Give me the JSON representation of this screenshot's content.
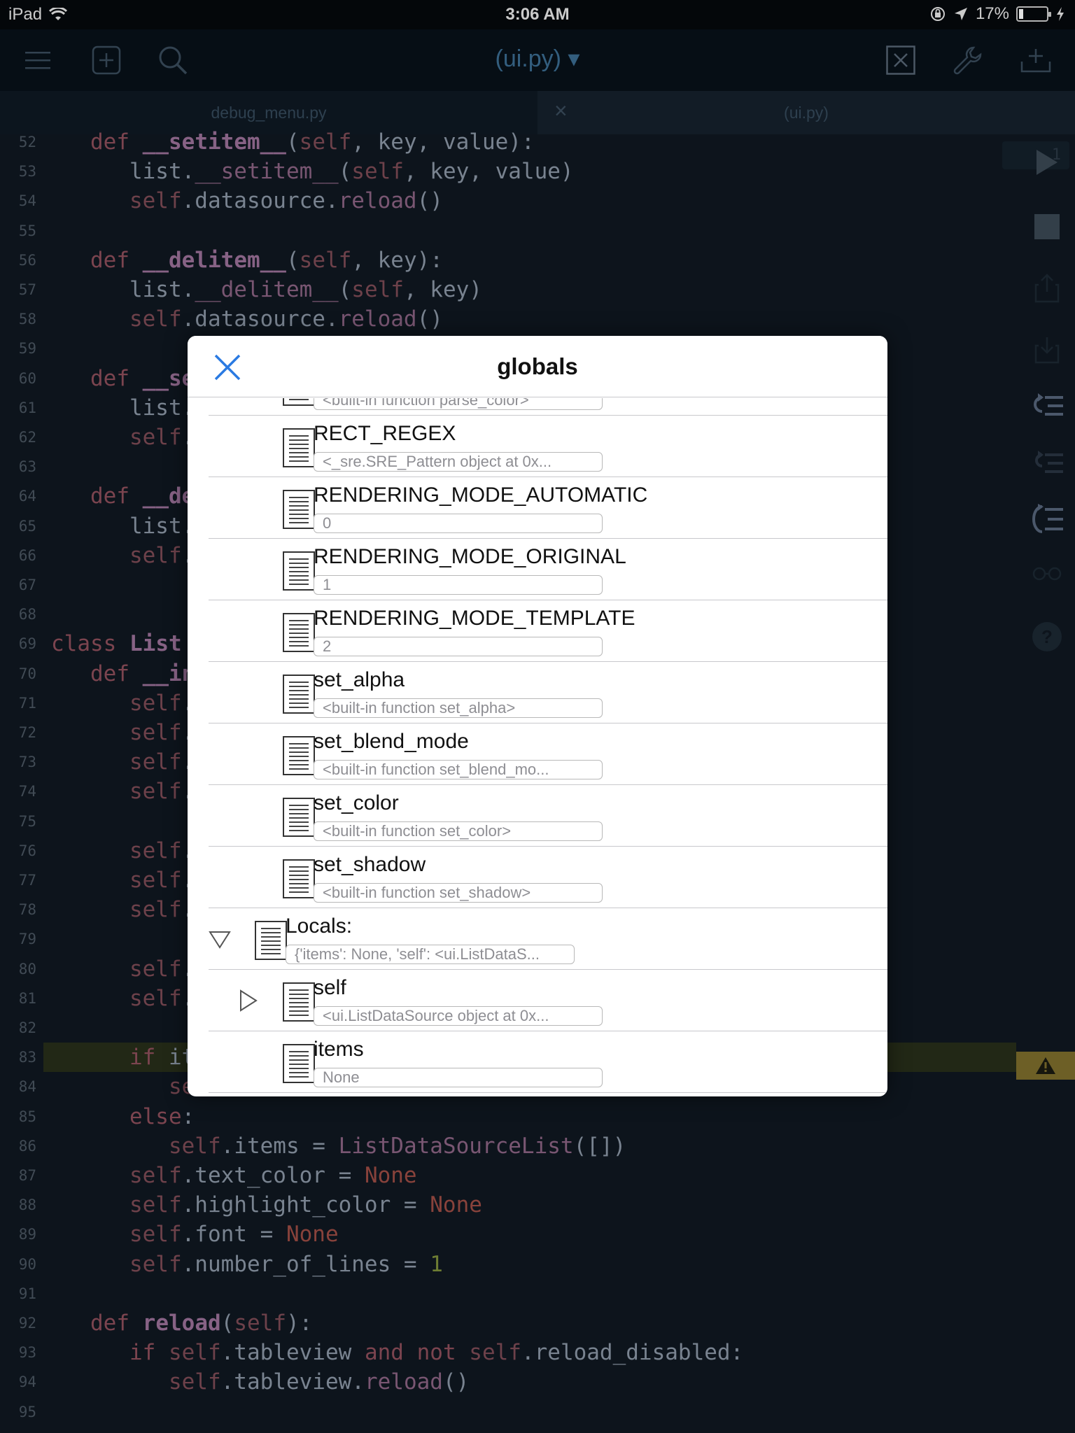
{
  "status_bar": {
    "device": "iPad",
    "time": "3:06 AM",
    "battery_percent": "17%",
    "battery_level": 0.17
  },
  "toolbar": {
    "title": "(ui.py) ▾"
  },
  "tabs": [
    {
      "label": "debug_menu.py",
      "close": ""
    },
    {
      "label": "(ui.py)",
      "close": "×"
    }
  ],
  "editor": {
    "lines": [
      {
        "n": "52",
        "html": "   <span class='kw'>def</span> <span class='fn'>__setitem__</span>(<span class='sf'>self</span>, key, value):"
      },
      {
        "n": "53",
        "html": "      list.<span class='mt'>__setitem__</span>(<span class='sf'>self</span>, key, value)"
      },
      {
        "n": "54",
        "html": "      <span class='sf'>self</span>.datasource.<span class='mt'>reload</span>()"
      },
      {
        "n": "55",
        "html": ""
      },
      {
        "n": "56",
        "html": "   <span class='kw'>def</span> <span class='fn'>__delitem__</span>(<span class='sf'>self</span>, key):"
      },
      {
        "n": "57",
        "html": "      list.<span class='mt'>__delitem__</span>(<span class='sf'>self</span>, key)"
      },
      {
        "n": "58",
        "html": "      <span class='sf'>self</span>.datasource.<span class='mt'>reload</span>()"
      },
      {
        "n": "59",
        "html": ""
      },
      {
        "n": "60",
        "html": "   <span class='kw'>def</span> <span class='fn'>__se</span>"
      },
      {
        "n": "61",
        "html": "      list."
      },
      {
        "n": "62",
        "html": "      <span class='sf'>self</span>."
      },
      {
        "n": "63",
        "html": ""
      },
      {
        "n": "64",
        "html": "   <span class='kw'>def</span> <span class='fn'>__de</span>"
      },
      {
        "n": "65",
        "html": "      list."
      },
      {
        "n": "66",
        "html": "      <span class='sf'>self</span>."
      },
      {
        "n": "67",
        "html": ""
      },
      {
        "n": "68",
        "html": ""
      },
      {
        "n": "69",
        "html": "<span class='kw'>class</span> <span class='fn'>List</span>"
      },
      {
        "n": "70",
        "html": "   <span class='kw'>def</span> <span class='fn'>__in</span>"
      },
      {
        "n": "71",
        "html": "      <span class='sf'>self</span>."
      },
      {
        "n": "72",
        "html": "      <span class='sf'>self</span>."
      },
      {
        "n": "73",
        "html": "      <span class='sf'>self</span>."
      },
      {
        "n": "74",
        "html": "      <span class='sf'>self</span>."
      },
      {
        "n": "75",
        "html": ""
      },
      {
        "n": "76",
        "html": "      <span class='sf'>self</span>."
      },
      {
        "n": "77",
        "html": "      <span class='sf'>self</span>."
      },
      {
        "n": "78",
        "html": "      <span class='sf'>self</span>."
      },
      {
        "n": "79",
        "html": ""
      },
      {
        "n": "80",
        "html": "      <span class='sf'>self</span>."
      },
      {
        "n": "81",
        "html": "      <span class='sf'>self</span>."
      },
      {
        "n": "82",
        "html": ""
      },
      {
        "n": "83",
        "html": "      <span class='kw'>if</span> it",
        "highlight": true
      },
      {
        "n": "84",
        "html": "         <span class='sf'>self</span>.items = items"
      },
      {
        "n": "85",
        "html": "      <span class='kw'>else</span>:"
      },
      {
        "n": "86",
        "html": "         <span class='sf'>self</span>.items = <span class='mt'>ListDataSourceList</span>([])"
      },
      {
        "n": "87",
        "html": "      <span class='sf'>self</span>.text_color = <span class='nn'>None</span>"
      },
      {
        "n": "88",
        "html": "      <span class='sf'>self</span>.highlight_color = <span class='nn'>None</span>"
      },
      {
        "n": "89",
        "html": "      <span class='sf'>self</span>.font = <span class='nn'>None</span>"
      },
      {
        "n": "90",
        "html": "      <span class='sf'>self</span>.number_of_lines = <span class='num'>1</span>"
      },
      {
        "n": "91",
        "html": ""
      },
      {
        "n": "92",
        "html": "   <span class='kw'>def</span> <span class='fn'>reload</span>(<span class='sf'>self</span>):"
      },
      {
        "n": "93",
        "html": "      <span class='kw'>if</span> <span class='sf'>self</span>.tableview <span class='kw'>and</span> <span class='kw'>not</span> <span class='sf'>self</span>.reload_disabled:"
      },
      {
        "n": "94",
        "html": "         <span class='sf'>self</span>.tableview.<span class='mt'>reload</span>()"
      },
      {
        "n": "95",
        "html": ""
      }
    ],
    "gutter_badge": "1"
  },
  "dialog": {
    "title": "globals",
    "rows": [
      {
        "name": "",
        "value": "<built-in function parse_color>",
        "indent": 1,
        "disclosure": ""
      },
      {
        "name": "RECT_REGEX",
        "value": "<_sre.SRE_Pattern object at 0x...",
        "indent": 1,
        "disclosure": ""
      },
      {
        "name": "RENDERING_MODE_AUTOMATIC",
        "value": "0",
        "indent": 1,
        "disclosure": ""
      },
      {
        "name": "RENDERING_MODE_ORIGINAL",
        "value": "1",
        "indent": 1,
        "disclosure": ""
      },
      {
        "name": "RENDERING_MODE_TEMPLATE",
        "value": "2",
        "indent": 1,
        "disclosure": ""
      },
      {
        "name": "set_alpha",
        "value": "<built-in function set_alpha>",
        "indent": 1,
        "disclosure": ""
      },
      {
        "name": "set_blend_mode",
        "value": "<built-in function set_blend_mo...",
        "indent": 1,
        "disclosure": ""
      },
      {
        "name": "set_color",
        "value": "<built-in function set_color>",
        "indent": 1,
        "disclosure": ""
      },
      {
        "name": "set_shadow",
        "value": "<built-in function set_shadow>",
        "indent": 1,
        "disclosure": ""
      },
      {
        "name": "Locals:",
        "value": "{'items': None, 'self': <ui.ListDataS...",
        "indent": 0,
        "disclosure": "expanded"
      },
      {
        "name": "self",
        "value": "<ui.ListDataSource object at 0x...",
        "indent": 1,
        "disclosure": "collapsed"
      },
      {
        "name": "items",
        "value": "None",
        "indent": 1,
        "disclosure": ""
      }
    ]
  },
  "colors": {
    "editor_bg": "#0f1720",
    "accent_blue": "#2a7ae2",
    "highlight_line": "#272e1a",
    "warning_badge": "#7d6d2c"
  }
}
